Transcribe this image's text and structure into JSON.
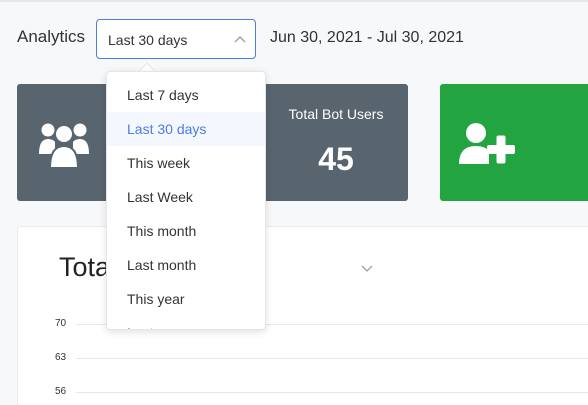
{
  "header": {
    "analytics_label": "Analytics",
    "range_select": {
      "value": "Last 30 days"
    },
    "date_range": "Jun 30, 2021 - Jul 30, 2021"
  },
  "dropdown": {
    "options": [
      {
        "label": "Last 7 days",
        "selected": false
      },
      {
        "label": "Last 30 days",
        "selected": true
      },
      {
        "label": "This week",
        "selected": false
      },
      {
        "label": "Last Week",
        "selected": false
      },
      {
        "label": "This month",
        "selected": false
      },
      {
        "label": "Last month",
        "selected": false
      },
      {
        "label": "This year",
        "selected": false
      },
      {
        "label": "Last year",
        "selected": false
      }
    ]
  },
  "cards": {
    "total_bot_users": {
      "title": "Total Bot Users",
      "value": "45",
      "color": "#58646e",
      "icon": "users-icon"
    },
    "new_users": {
      "color": "#22a540",
      "icon": "add-user-icon"
    }
  },
  "chart": {
    "title": "Total",
    "y_ticks": [
      "70",
      "63",
      "56"
    ]
  },
  "colors": {
    "accent": "#4d7ce4",
    "selected_bg": "#f4f7fd"
  }
}
